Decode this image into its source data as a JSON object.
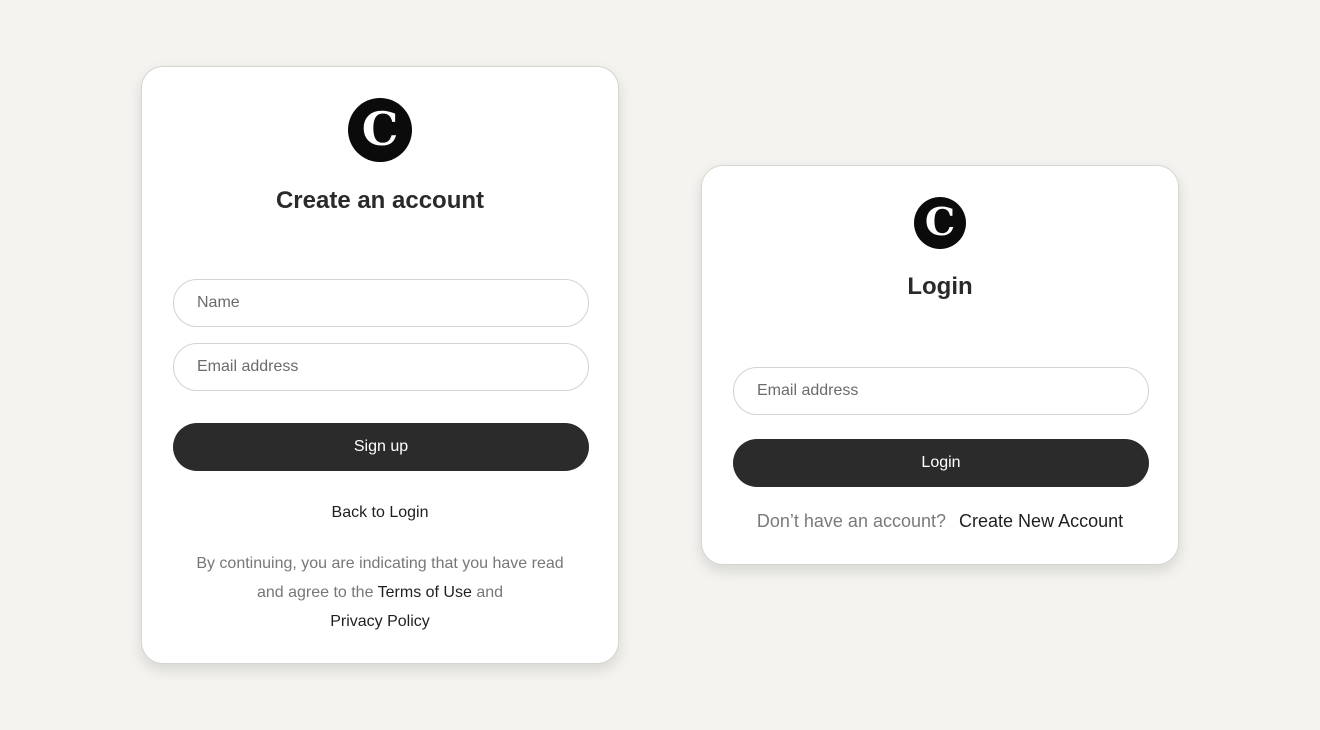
{
  "signup": {
    "logo_letter": "C",
    "title": "Create an account",
    "name_placeholder": "Name",
    "email_placeholder": "Email address",
    "submit_label": "Sign up",
    "back_link": "Back to Login",
    "legal": {
      "text_before": "By continuing, you are indicating that you have read and agree to the",
      "terms_link": "Terms of Use",
      "text_middle": "and",
      "privacy_link": "Privacy Policy"
    }
  },
  "login": {
    "logo_letter": "C",
    "title": "Login",
    "email_placeholder": "Email address",
    "submit_label": "Login",
    "no_account_text": "Don’t have an account?",
    "create_account_link": "Create New Account"
  },
  "colors": {
    "background": "#f4f3ef",
    "button": "#2b2b2b",
    "logo": "#0b0b0b"
  }
}
